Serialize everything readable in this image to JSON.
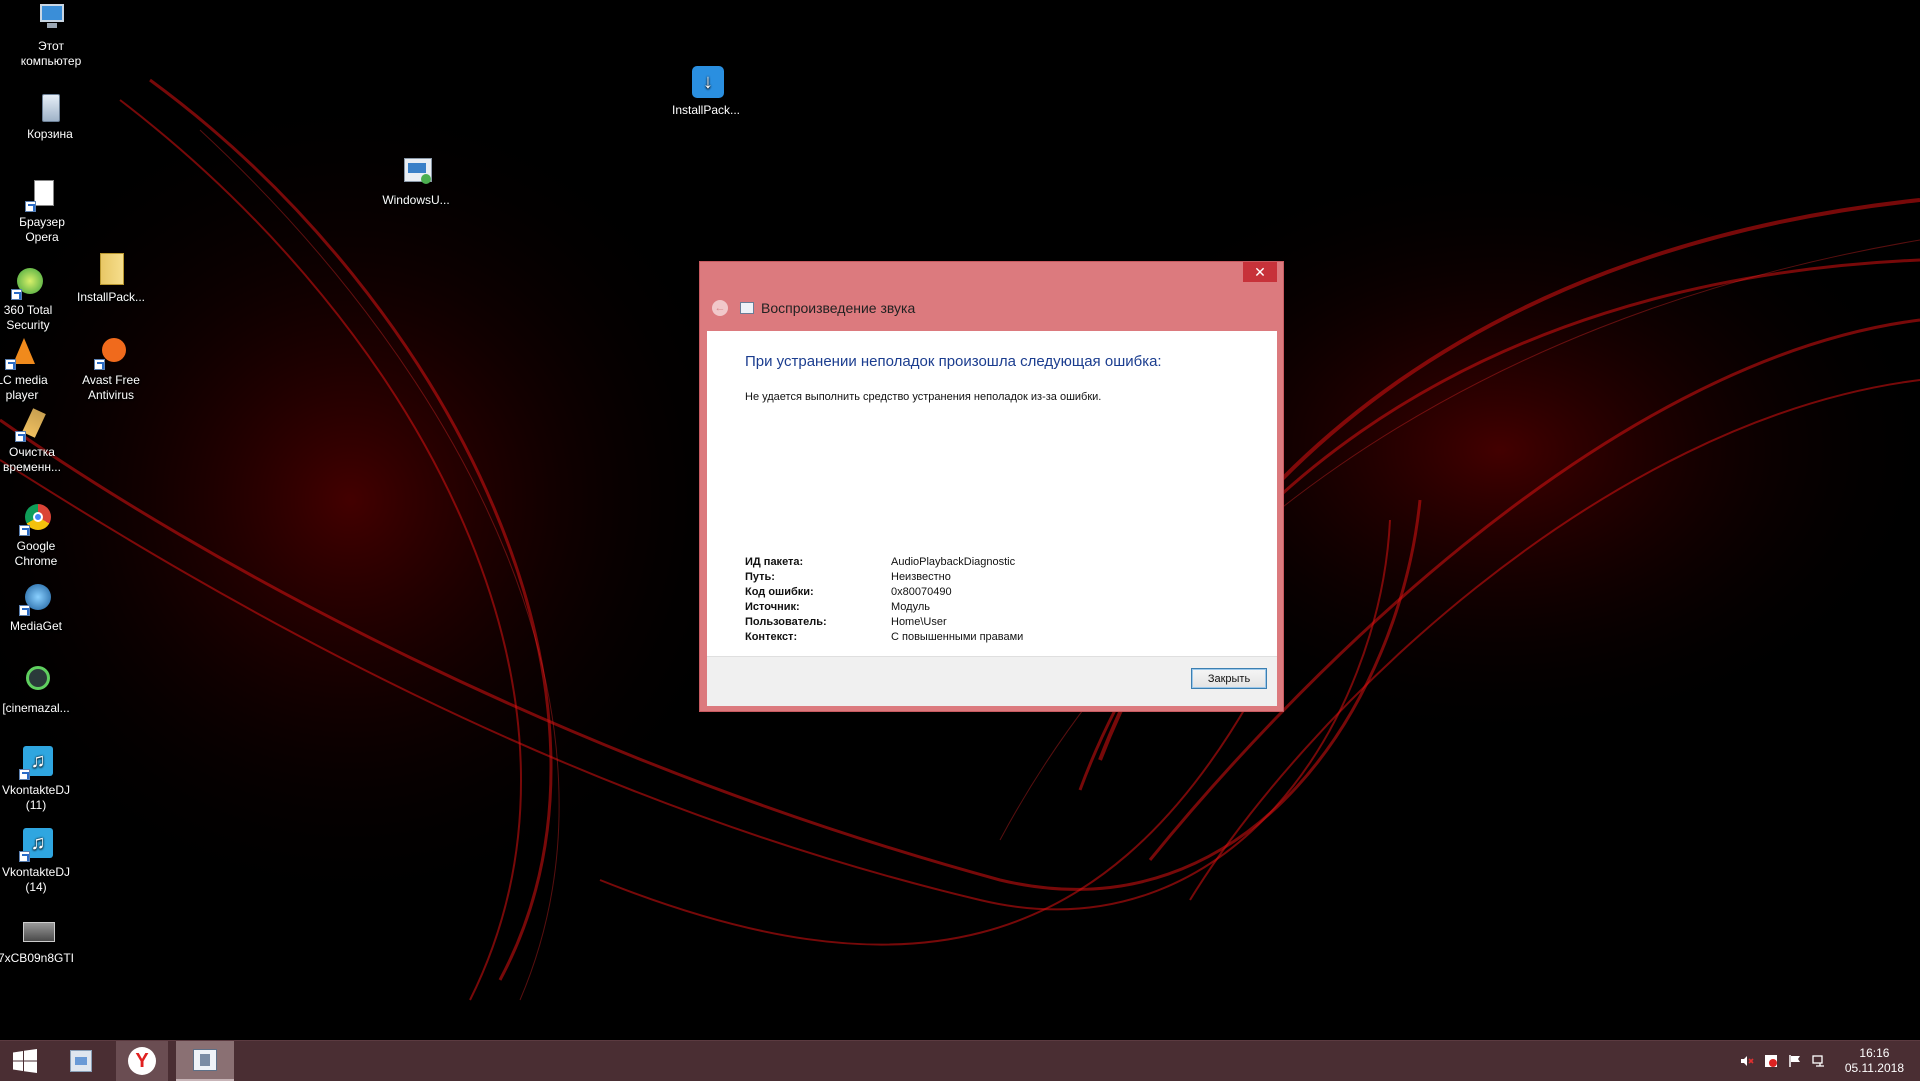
{
  "desktop": {
    "icons": [
      {
        "label": "Этот\nкомпьютер",
        "icon": "computer-icon"
      },
      {
        "label": "Корзина",
        "icon": "recycle-bin-icon"
      },
      {
        "label": "Браузер\nOpera",
        "icon": "opera-icon"
      },
      {
        "label": "360 Total\nSecurity",
        "icon": "360-security-icon"
      },
      {
        "label": "InstallPack...",
        "icon": "folder-icon"
      },
      {
        "label": "LC media\nplayer",
        "icon": "vlc-icon"
      },
      {
        "label": "Avast Free\nAntivirus",
        "icon": "avast-icon"
      },
      {
        "label": "Очистка\nвременн...",
        "icon": "cleanup-icon"
      },
      {
        "label": "Google\nChrome",
        "icon": "chrome-icon"
      },
      {
        "label": "MediaGet",
        "icon": "mediaget-icon"
      },
      {
        "label": "[cinemazal...",
        "icon": "torrent-icon"
      },
      {
        "label": "VkontakteDJ\n(11)",
        "icon": "music-icon"
      },
      {
        "label": "VkontakteDJ\n(14)",
        "icon": "music-icon"
      },
      {
        "label": "7xCB09n8GTI",
        "icon": "image-icon"
      },
      {
        "label": "WindowsU...",
        "icon": "windows-update-icon"
      },
      {
        "label": "InstallPack...",
        "icon": "installpack-icon"
      }
    ]
  },
  "dialog": {
    "title": "Воспроизведение звука",
    "close_glyph": "✕",
    "back_glyph": "←",
    "headline": "При устранении неполадок произошла следующая ошибка:",
    "error_text": "Не удается выполнить средство устранения неполадок из-за ошибки.",
    "details": [
      {
        "key": "ИД пакета:",
        "value": "AudioPlaybackDiagnostic"
      },
      {
        "key": "Путь:",
        "value": "Неизвестно"
      },
      {
        "key": "Код ошибки:",
        "value": "0x80070490"
      },
      {
        "key": "Источник:",
        "value": "Модуль"
      },
      {
        "key": "Пользователь:",
        "value": "Home\\User"
      },
      {
        "key": "Контекст:",
        "value": "С повышенными правами"
      }
    ],
    "close_button": "Закрыть"
  },
  "taskbar": {
    "clock_time": "16:16",
    "clock_date": "05.11.2018",
    "tray_icons": [
      "speaker-muted-icon",
      "antivirus-tray-icon",
      "action-center-flag-icon",
      "network-icon"
    ]
  },
  "colors": {
    "dialog_frame": "#dc7a7e",
    "close_red": "#c7323a",
    "headline_blue": "#1b3d8f",
    "taskbar": "#4a2e33"
  }
}
